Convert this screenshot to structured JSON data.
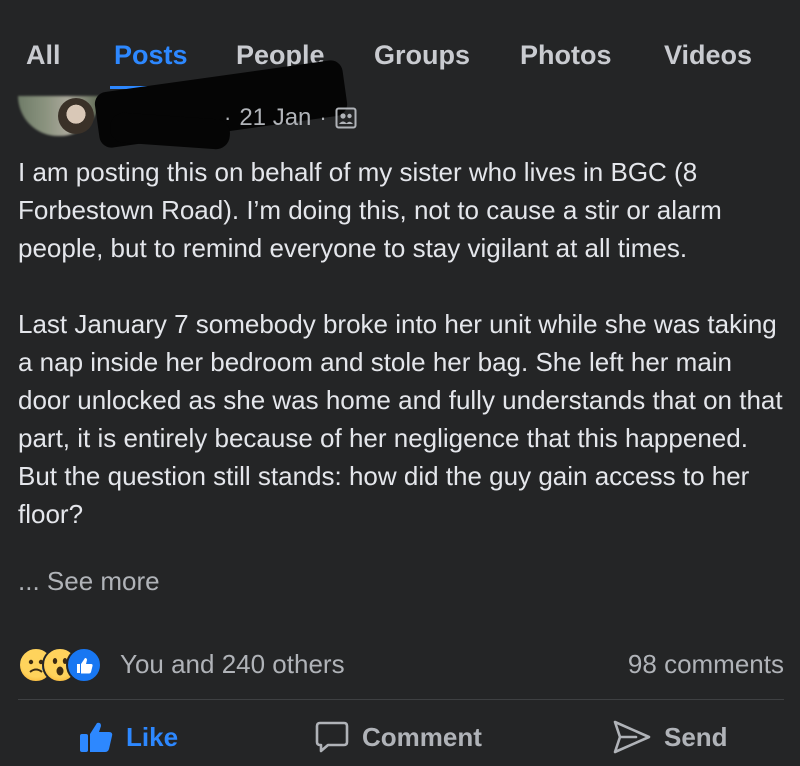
{
  "tabs": {
    "all": "All",
    "posts": "Posts",
    "people": "People",
    "groups": "Groups",
    "photos": "Photos",
    "videos": "Videos"
  },
  "post": {
    "date": "21 Jan",
    "separator": "·",
    "paragraph_1": "I am posting this on behalf of my sister who lives in BGC (8 Forbestown Road). I’m doing this, not to cause a stir or alarm people, but to remind everyone to stay vigilant at all times.",
    "paragraph_2": "Last January 7 somebody broke into her unit while she was taking a nap inside her bedroom and stole her bag. She left her main door unlocked as she was home and fully understands that on that part, it is entirely because of her negligence that this happened. But the question still stands: how did the guy gain access to her floor?",
    "see_more": "... See more"
  },
  "reactions": {
    "summary": "You and 240 others",
    "comments": "98 comments",
    "icons": [
      "sad-reaction",
      "wow-reaction",
      "like-reaction"
    ]
  },
  "actions": {
    "like": "Like",
    "comment": "Comment",
    "send": "Send"
  },
  "colors": {
    "background": "#242526",
    "accent": "#2d88ff",
    "text": "#e4e6eb",
    "muted": "#b0b3b8"
  }
}
